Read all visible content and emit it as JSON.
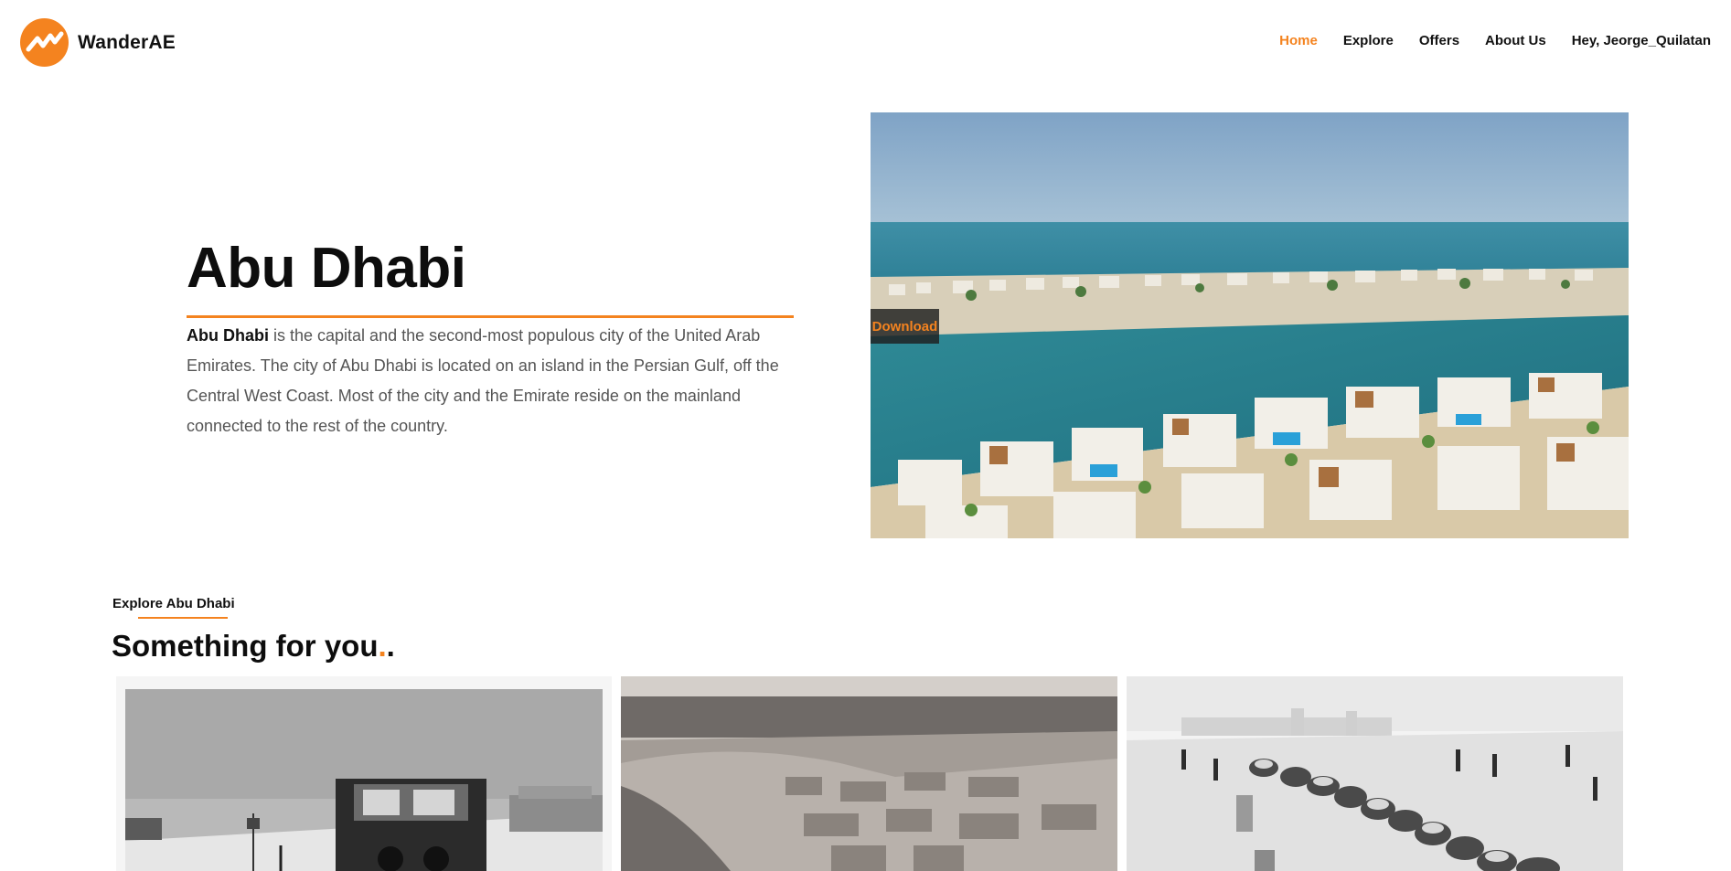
{
  "brand": {
    "name": "WanderAE",
    "logo_icon": "wave-chart-logo-icon",
    "accent": "#f4831f"
  },
  "nav": {
    "items": [
      {
        "label": "Home",
        "active": true
      },
      {
        "label": "Explore",
        "active": false
      },
      {
        "label": "Offers",
        "active": false
      },
      {
        "label": "About Us",
        "active": false
      },
      {
        "label": "Hey, Jeorge_Quilatan",
        "active": false
      }
    ]
  },
  "hero": {
    "title": "Abu Dhabi",
    "description_bold": "Abu Dhabi",
    "description_rest": " is the capital and the second-most populous city of the United Arab Emirates. The city of Abu Dhabi is located on an island in the Persian Gulf, off the Central West Coast. Most of the city and the Emirate reside on the mainland connected to the rest of the country.",
    "download_label": "Download"
  },
  "section": {
    "kicker": "Explore Abu Dhabi",
    "title_text": "Something for you",
    "title_dot_accent": ".",
    "title_dot_plain": "."
  }
}
